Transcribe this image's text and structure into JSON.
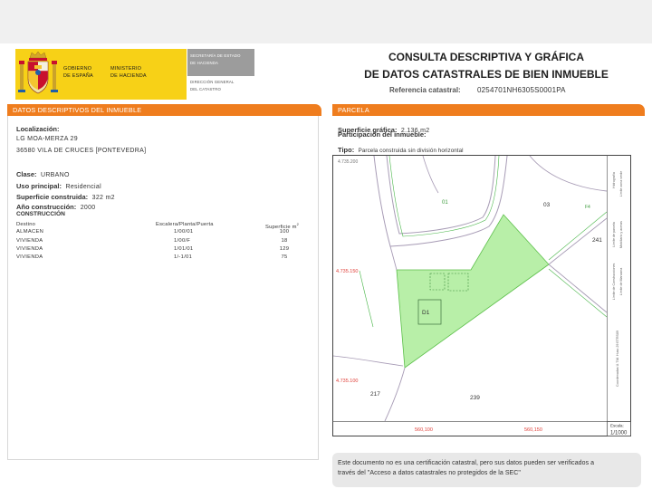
{
  "header": {
    "logo_icon": "spain-coat-of-arms-icon",
    "gobierno": [
      "GOBIERNO",
      "DE ESPAÑA"
    ],
    "ministerio": [
      "MINISTERIO",
      "DE HACIENDA"
    ],
    "secretaria": [
      "SECRETARÍA DE ESTADO",
      "DE HACIENDA"
    ],
    "direccion": [
      "DIRECCIÓN GENERAL",
      "DEL CATASTRO"
    ],
    "title": [
      "CONSULTA DESCRIPTIVA Y GRÁFICA",
      "DE DATOS CATASTRALES DE BIEN INMUEBLE"
    ],
    "ref_label": "Referencia catastral:",
    "ref_value": "0254701NH6305S0001PA"
  },
  "descriptivos": {
    "heading": "DATOS DESCRIPTIVOS DEL INMUEBLE",
    "localizacion_label": "Localización:",
    "address_line1": "LG MOA-MERZA 29",
    "address_line2": "36580 VILA DE CRUCES [PONTEVEDRA]",
    "fields": [
      {
        "label": "Clase:",
        "value": "URBANO"
      },
      {
        "label": "Uso principal:",
        "value": "Residencial"
      },
      {
        "label": "Superficie construida:",
        "value": "322 m2"
      },
      {
        "label": "Año construcción:",
        "value": "2000"
      }
    ],
    "construccion": {
      "heading": "CONSTRUCCIÓN",
      "columns": [
        "Destino",
        "Escalera/Planta/Puerta",
        "Superficie m"
      ],
      "superscript": "2",
      "rows": [
        {
          "destino": "ALMACEN",
          "escalera": "1/00/01",
          "superficie": "100"
        },
        {
          "destino": "VIVIENDA",
          "escalera": "1/00/F",
          "superficie": "18"
        },
        {
          "destino": "VIVIENDA",
          "escalera": "1/01/01",
          "superficie": "129"
        },
        {
          "destino": "VIVIENDA",
          "escalera": "1/-1/01",
          "superficie": "75"
        }
      ]
    }
  },
  "parcela": {
    "heading": "PARCELA",
    "superficie_label": "Superficie gráfica:",
    "superficie_value": "2.136 m2",
    "participacion_label": "Participación del inmueble:",
    "tipo_label": "Tipo:",
    "tipo_value": "Parcela construida sin división horizontal",
    "map": {
      "coord_labels": [
        "4.735.200",
        "4.735.150",
        "4.735.100",
        "560,100",
        "560,150"
      ],
      "parcel_labels": [
        "01",
        "03",
        "F4",
        "241",
        "D1",
        "217",
        "239"
      ],
      "legend": [
        "Hidrografía",
        "Límite zona verde",
        "Límite de parcela",
        "Mobiliario y aceras",
        "Límite de Construcciones",
        "Límite de Manzana",
        "Coordenadas U.T.M. Huso 29 ETRS89"
      ],
      "scale_label": "Escala:",
      "scale_value": "1/1000"
    }
  },
  "footer": {
    "line1": "Este documento no es una certificación catastral, pero sus datos pueden ser verificados a",
    "line2": "través del \"Acceso a datos catastrales no protegidos de la SEC\""
  },
  "colors": {
    "accent_orange": "#ef7d1e",
    "brand_yellow": "#f7d117",
    "parcel_fill": "#b8efa8",
    "coordinate_red": "#e0403a",
    "road_gray": "#a79bb5"
  }
}
